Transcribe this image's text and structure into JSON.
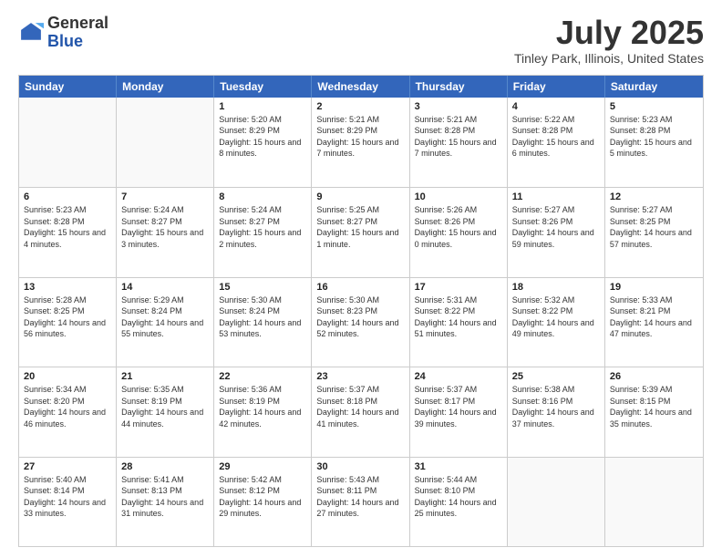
{
  "logo": {
    "general": "General",
    "blue": "Blue"
  },
  "title": "July 2025",
  "location": "Tinley Park, Illinois, United States",
  "weekdays": [
    "Sunday",
    "Monday",
    "Tuesday",
    "Wednesday",
    "Thursday",
    "Friday",
    "Saturday"
  ],
  "weeks": [
    [
      {
        "day": "",
        "info": ""
      },
      {
        "day": "",
        "info": ""
      },
      {
        "day": "1",
        "info": "Sunrise: 5:20 AM\nSunset: 8:29 PM\nDaylight: 15 hours and 8 minutes."
      },
      {
        "day": "2",
        "info": "Sunrise: 5:21 AM\nSunset: 8:29 PM\nDaylight: 15 hours and 7 minutes."
      },
      {
        "day": "3",
        "info": "Sunrise: 5:21 AM\nSunset: 8:28 PM\nDaylight: 15 hours and 7 minutes."
      },
      {
        "day": "4",
        "info": "Sunrise: 5:22 AM\nSunset: 8:28 PM\nDaylight: 15 hours and 6 minutes."
      },
      {
        "day": "5",
        "info": "Sunrise: 5:23 AM\nSunset: 8:28 PM\nDaylight: 15 hours and 5 minutes."
      }
    ],
    [
      {
        "day": "6",
        "info": "Sunrise: 5:23 AM\nSunset: 8:28 PM\nDaylight: 15 hours and 4 minutes."
      },
      {
        "day": "7",
        "info": "Sunrise: 5:24 AM\nSunset: 8:27 PM\nDaylight: 15 hours and 3 minutes."
      },
      {
        "day": "8",
        "info": "Sunrise: 5:24 AM\nSunset: 8:27 PM\nDaylight: 15 hours and 2 minutes."
      },
      {
        "day": "9",
        "info": "Sunrise: 5:25 AM\nSunset: 8:27 PM\nDaylight: 15 hours and 1 minute."
      },
      {
        "day": "10",
        "info": "Sunrise: 5:26 AM\nSunset: 8:26 PM\nDaylight: 15 hours and 0 minutes."
      },
      {
        "day": "11",
        "info": "Sunrise: 5:27 AM\nSunset: 8:26 PM\nDaylight: 14 hours and 59 minutes."
      },
      {
        "day": "12",
        "info": "Sunrise: 5:27 AM\nSunset: 8:25 PM\nDaylight: 14 hours and 57 minutes."
      }
    ],
    [
      {
        "day": "13",
        "info": "Sunrise: 5:28 AM\nSunset: 8:25 PM\nDaylight: 14 hours and 56 minutes."
      },
      {
        "day": "14",
        "info": "Sunrise: 5:29 AM\nSunset: 8:24 PM\nDaylight: 14 hours and 55 minutes."
      },
      {
        "day": "15",
        "info": "Sunrise: 5:30 AM\nSunset: 8:24 PM\nDaylight: 14 hours and 53 minutes."
      },
      {
        "day": "16",
        "info": "Sunrise: 5:30 AM\nSunset: 8:23 PM\nDaylight: 14 hours and 52 minutes."
      },
      {
        "day": "17",
        "info": "Sunrise: 5:31 AM\nSunset: 8:22 PM\nDaylight: 14 hours and 51 minutes."
      },
      {
        "day": "18",
        "info": "Sunrise: 5:32 AM\nSunset: 8:22 PM\nDaylight: 14 hours and 49 minutes."
      },
      {
        "day": "19",
        "info": "Sunrise: 5:33 AM\nSunset: 8:21 PM\nDaylight: 14 hours and 47 minutes."
      }
    ],
    [
      {
        "day": "20",
        "info": "Sunrise: 5:34 AM\nSunset: 8:20 PM\nDaylight: 14 hours and 46 minutes."
      },
      {
        "day": "21",
        "info": "Sunrise: 5:35 AM\nSunset: 8:19 PM\nDaylight: 14 hours and 44 minutes."
      },
      {
        "day": "22",
        "info": "Sunrise: 5:36 AM\nSunset: 8:19 PM\nDaylight: 14 hours and 42 minutes."
      },
      {
        "day": "23",
        "info": "Sunrise: 5:37 AM\nSunset: 8:18 PM\nDaylight: 14 hours and 41 minutes."
      },
      {
        "day": "24",
        "info": "Sunrise: 5:37 AM\nSunset: 8:17 PM\nDaylight: 14 hours and 39 minutes."
      },
      {
        "day": "25",
        "info": "Sunrise: 5:38 AM\nSunset: 8:16 PM\nDaylight: 14 hours and 37 minutes."
      },
      {
        "day": "26",
        "info": "Sunrise: 5:39 AM\nSunset: 8:15 PM\nDaylight: 14 hours and 35 minutes."
      }
    ],
    [
      {
        "day": "27",
        "info": "Sunrise: 5:40 AM\nSunset: 8:14 PM\nDaylight: 14 hours and 33 minutes."
      },
      {
        "day": "28",
        "info": "Sunrise: 5:41 AM\nSunset: 8:13 PM\nDaylight: 14 hours and 31 minutes."
      },
      {
        "day": "29",
        "info": "Sunrise: 5:42 AM\nSunset: 8:12 PM\nDaylight: 14 hours and 29 minutes."
      },
      {
        "day": "30",
        "info": "Sunrise: 5:43 AM\nSunset: 8:11 PM\nDaylight: 14 hours and 27 minutes."
      },
      {
        "day": "31",
        "info": "Sunrise: 5:44 AM\nSunset: 8:10 PM\nDaylight: 14 hours and 25 minutes."
      },
      {
        "day": "",
        "info": ""
      },
      {
        "day": "",
        "info": ""
      }
    ]
  ]
}
